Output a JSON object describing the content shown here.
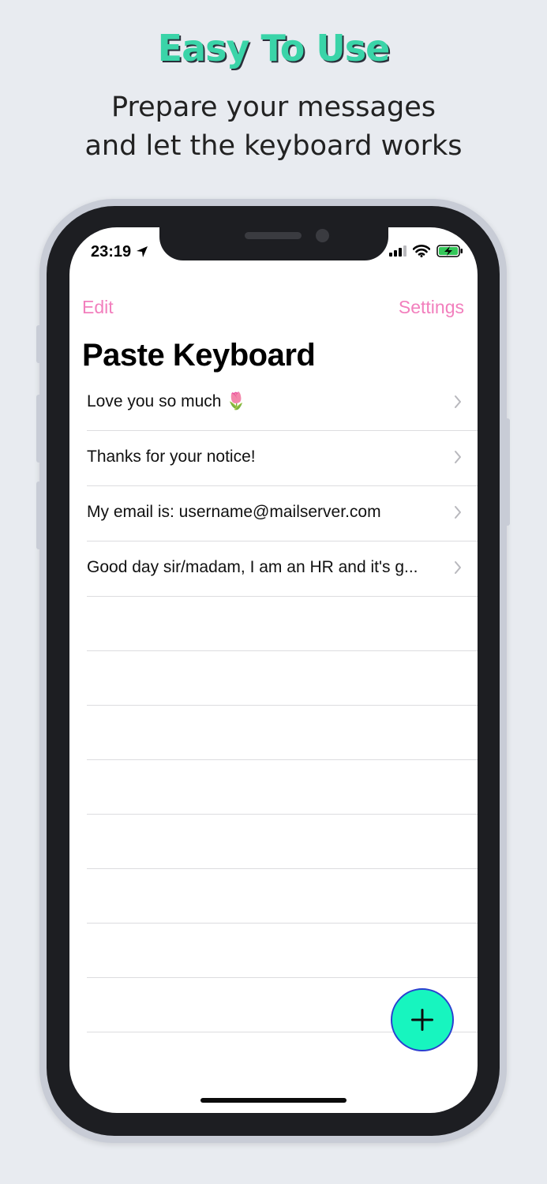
{
  "promo": {
    "headline": "Easy To Use",
    "subline": "Prepare your messages\nand let the keyboard works"
  },
  "status_bar": {
    "time": "23:19",
    "icons": [
      "location-arrow-icon",
      "signal-icon",
      "wifi-icon",
      "battery-charging-icon"
    ]
  },
  "nav": {
    "edit_label": "Edit",
    "settings_label": "Settings"
  },
  "page_title": "Paste Keyboard",
  "messages": [
    "Love you so much 🌷",
    "Thanks for your notice!",
    "My email is: username@mailserver.com",
    "Good day sir/madam, I am an HR and it's g..."
  ],
  "colors": {
    "accent": "#f27fbd",
    "headline": "#3ad4a8",
    "fab": "#17f5bf",
    "fab_border": "#2a3fd0"
  },
  "fab_icon": "plus-icon"
}
